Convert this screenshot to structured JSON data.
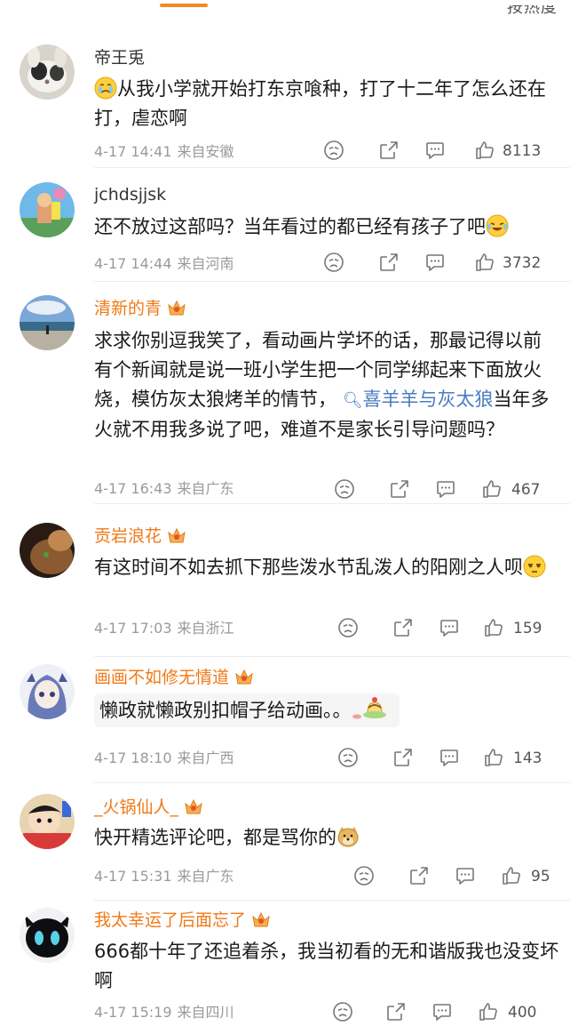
{
  "header": {
    "sort_label": "按热度"
  },
  "comments": [
    {
      "username": "帝王兎",
      "text": "从我小学就开始打东京喰种，打了十二年了怎么还在打，虐恋啊",
      "time": "4-17 14:41",
      "source": "来自安徽",
      "likes": "8113"
    },
    {
      "username": "jchdsjjsk",
      "text": "还不放过这部吗？当年看过的都已经有孩子了吧",
      "time": "4-17 14:44",
      "source": "来自河南",
      "likes": "3732"
    },
    {
      "username": "清新的青",
      "text_a": "求求你别逗我笑了，看动画片学坏的话，那最记得以前有个新闻就是说一班小学生把一个同学绑起来下面放火烧，模仿灰太狼烤羊的情节，",
      "tag": "喜羊羊与灰太狼",
      "text_b": "当年多火就不用我多说了吧，难道不是家长引导问题吗？",
      "time": "4-17 16:43",
      "source": "来自广东",
      "likes": "467"
    },
    {
      "username": "贡岩浪花",
      "text": "有这时间不如去抓下那些泼水节乱泼人的阳刚之人呗",
      "time": "4-17 17:03",
      "source": "来自浙江",
      "likes": "159"
    },
    {
      "username": "画画不如修无情道",
      "text": "懒政就懒政别扣帽子给动画。。",
      "time": "4-17 18:10",
      "source": "来自广西",
      "likes": "143"
    },
    {
      "username": "_火锅仙人_",
      "text": "快开精选评论吧，都是骂你的",
      "time": "4-17 15:31",
      "source": "来自广东",
      "likes": "95"
    },
    {
      "username": "我太幸运了后面忘了",
      "text": "666都十年了还追着杀，我当初看的无和谐版我也没变坏啊",
      "time": "4-17 15:19",
      "source": "来自四川",
      "likes": "400"
    }
  ],
  "colors": {
    "accent": "#f07a18",
    "topic_link": "#4a7cc0",
    "meta": "#9a9a9a"
  },
  "icons": [
    "dislike-icon",
    "share-icon",
    "reply-icon",
    "like-icon",
    "crown-badge-icon"
  ]
}
